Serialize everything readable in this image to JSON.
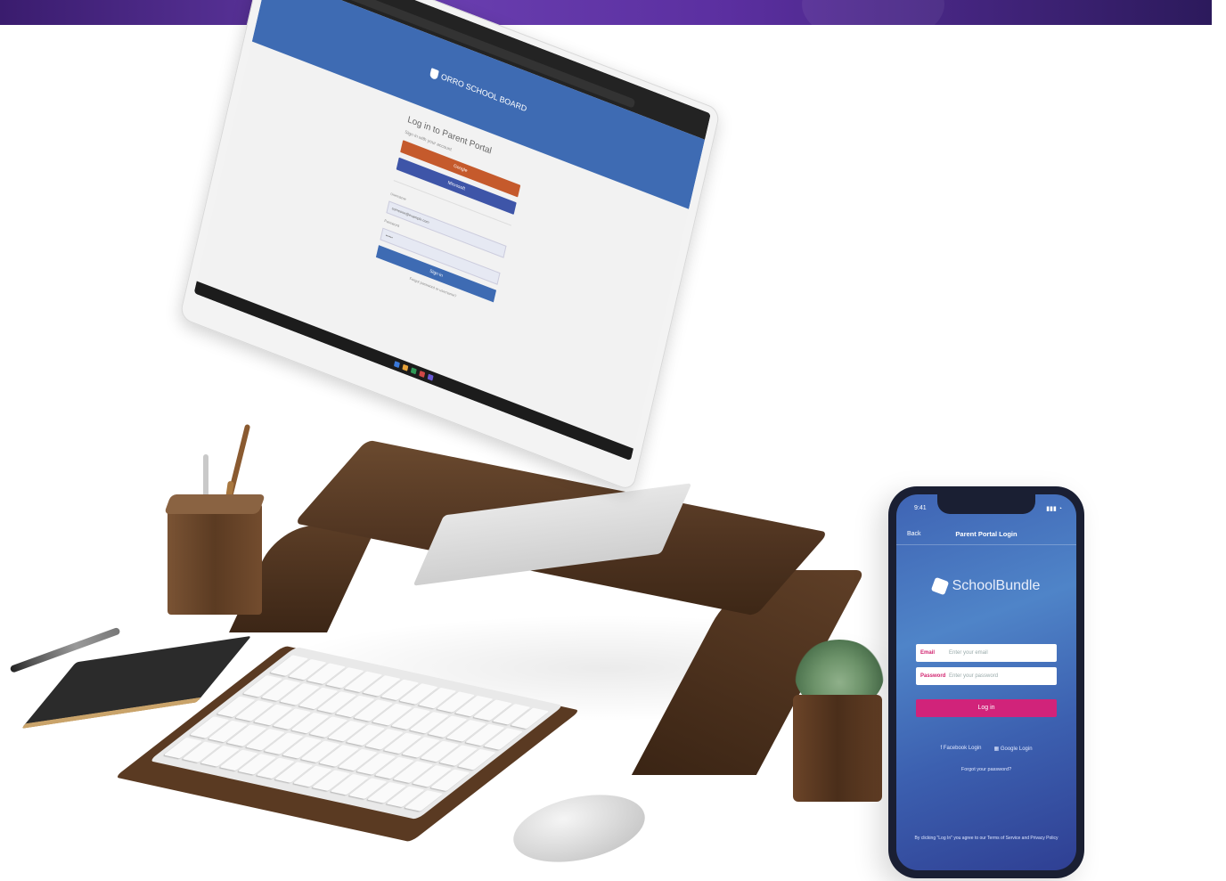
{
  "desktop": {
    "header_brand": "ORRO SCHOOL BOARD",
    "login_title": "Log in to Parent Portal",
    "login_subtitle": "Sign in with your account",
    "sso_google_label": "Google",
    "sso_microsoft_label": "Microsoft",
    "username_label": "Username",
    "username_value": "someone@example.com",
    "password_label": "Password",
    "password_value": "••••••",
    "signin_label": "Sign in",
    "forgot_label": "Forgot password or username?"
  },
  "phone": {
    "status_time": "9:41",
    "status_icons": "▮▮▮ ◔",
    "nav_back": "Back",
    "nav_title": "Parent Portal Login",
    "brand_name": "SchoolBundle",
    "email_label": "Email",
    "email_placeholder": "Enter your email",
    "password_label": "Password",
    "password_placeholder": "Enter your password",
    "login_button": "Log in",
    "facebook_login": "Facebook Login",
    "google_login": "Google Login",
    "forgot_password": "Forgot your password?",
    "terms_text": "By clicking \"Log In\" you agree to our Terms of Service and Privacy Policy"
  },
  "colors": {
    "banner_purple": "#5b2fa0",
    "portal_blue": "#3e6bb3",
    "sso_orange": "#c55a2c",
    "phone_pink": "#d1237a",
    "wood": "#5a3a22"
  }
}
